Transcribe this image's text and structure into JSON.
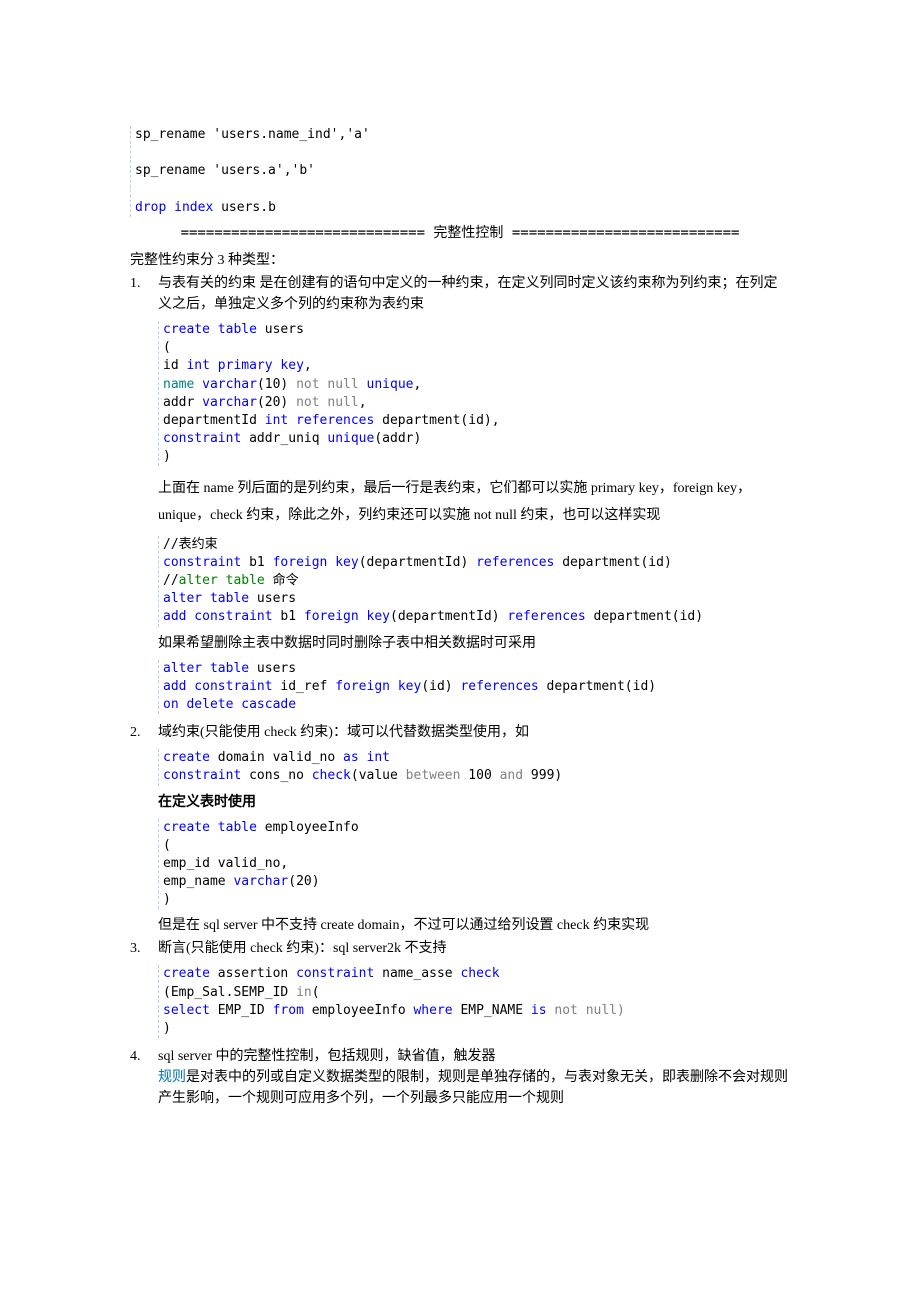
{
  "code_top": {
    "line1": "sp_rename 'users.name_ind','a'",
    "line2": "sp_rename 'users.a','b'",
    "line3_a": "drop",
    "line3_b": " index",
    "line3_c": " users.",
    "line3_d": "b"
  },
  "divider": "============================= 完整性控制 ===========================",
  "intro": "完整性约束分 3 种类型：",
  "item1": {
    "num": "1.",
    "text": "与表有关的约束 是在创建有的语句中定义的一种约束，在定义列同时定义该约束称为列约束；在列定义之后，单独定义多个列的约束称为表约束"
  },
  "code1": {
    "l1a": "create",
    "l1b": " table",
    "l1c": " users",
    "l2": "(",
    "l3a": "id ",
    "l3b": "int",
    "l3c": " primary",
    "l3d": " key",
    "l3e": ",",
    "l4a": "name",
    "l4b": " varchar",
    "l4c": "(10)",
    "l4d": " not",
    "l4e": " null",
    "l4f": " unique",
    "l4g": ",",
    "l5a": "addr ",
    "l5b": "varchar",
    "l5c": "(20)",
    "l5d": " not",
    "l5e": " null",
    "l5f": ",",
    "l6a": "departmentId ",
    "l6b": "int",
    "l6c": " references",
    "l6d": " department(id),",
    "l7a": "constraint",
    "l7b": " addr_uniq ",
    "l7c": "unique",
    "l7d": "(addr)",
    "l8": ")"
  },
  "para1": "上面在 name 列后面的是列约束，最后一行是表约束，它们都可以实施 primary key，foreign key，unique，check 约束，除此之外，列约束还可以实施 not null 约束，也可以这样实现",
  "code2": {
    "l1": "//表约束",
    "l2a": "constraint",
    "l2b": " b1 ",
    "l2c": "foreign",
    "l2d": " key",
    "l2e": "(departmentId)",
    "l2f": " references",
    "l2g": " department(id)",
    "l3a": "//",
    "l3b": "alter table ",
    "l3c": "命令",
    "l4a": "alter",
    "l4b": " table",
    "l4c": " users",
    "l5a": "add",
    "l5b": " constraint",
    "l5c": " b1 ",
    "l5d": "foreign",
    "l5e": " key",
    "l5f": "(departmentId)",
    "l5g": " references",
    "l5h": " department(id)"
  },
  "para2": "如果希望删除主表中数据时同时删除子表中相关数据时可采用",
  "code3": {
    "l1a": "alter",
    "l1b": " table",
    "l1c": " users",
    "l2a": "add",
    "l2b": " constraint",
    "l2c": " id_ref ",
    "l2d": "foreign",
    "l2e": " key",
    "l2f": "(id)",
    "l2g": " references",
    "l2h": " department(id)",
    "l3a": "on",
    "l3b": " delete",
    "l3c": " cascade"
  },
  "item2": {
    "num": "2.",
    "text": "域约束(只能使用 check 约束)：域可以代替数据类型使用，如"
  },
  "code4": {
    "l1a": "create",
    "l1b": " domain valid_no ",
    "l1c": "as",
    "l1d": " int",
    "l2a": "constraint",
    "l2b": " cons_no ",
    "l2c": "check",
    "l2d": "(value",
    "l2e": " between",
    "l2f": " 100 ",
    "l2g": "and",
    "l2h": " 999)"
  },
  "para3": "在定义表时使用",
  "code5": {
    "l1a": "create",
    "l1b": " table",
    "l1c": " employeeInfo",
    "l2": "(",
    "l3": "emp_id valid_no,",
    "l4a": "emp_name ",
    "l4b": "varchar",
    "l4c": "(20)",
    "l5": ")"
  },
  "para4": "但是在 sql server 中不支持 create domain，不过可以通过给列设置 check 约束实现",
  "item3": {
    "num": "3.",
    "text": "断言(只能使用 check 约束)：sql server2k 不支持"
  },
  "code6": {
    "l1a": "create",
    "l1b": " assertion ",
    "l1c": "constraint",
    "l1d": " name_asse ",
    "l1e": "check",
    "l2a": "(Emp_Sal.SEMP_ID ",
    "l2b": "in",
    "l2c": "(",
    "l3a": "select",
    "l3b": " EMP_ID ",
    "l3c": "from",
    "l3d": " employeeInfo ",
    "l3e": "where",
    "l3f": " EMP_NAME ",
    "l3g": "is",
    "l3h": " not",
    "l3i": " null)",
    "l4": ")"
  },
  "item4": {
    "num": "4.",
    "line1": "sql server 中的完整性控制，包括规则，缺省值，触发器",
    "link": "规则",
    "line2": "是对表中的列或自定义数据类型的限制，规则是单独存储的，与表对象无关，即表删除不会对规则产生影响，一个规则可应用多个列，一个列最多只能应用一个规则"
  }
}
